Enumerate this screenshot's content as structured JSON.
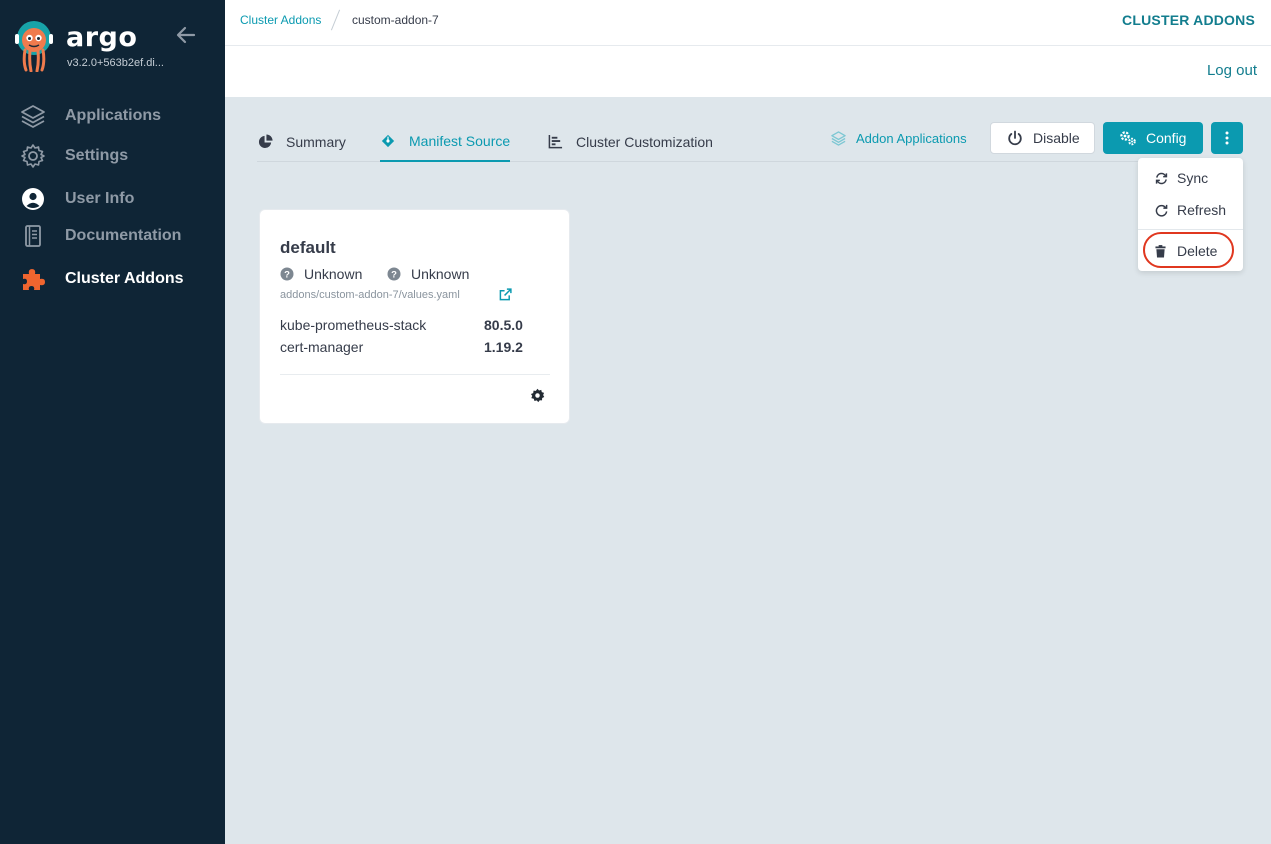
{
  "sidebar": {
    "logo_text": "argo",
    "version": "v3.2.0+563b2ef.di...",
    "items": [
      {
        "label": "Applications",
        "icon": "layers-icon"
      },
      {
        "label": "Settings",
        "icon": "gear-icon"
      },
      {
        "label": "User Info",
        "icon": "user-circle-icon"
      },
      {
        "label": "Documentation",
        "icon": "book-icon"
      },
      {
        "label": "Cluster Addons",
        "icon": "puzzle-icon",
        "active": true
      }
    ]
  },
  "header": {
    "breadcrumb": [
      "Cluster Addons",
      "custom-addon-7"
    ],
    "title": "CLUSTER ADDONS",
    "logout": "Log out"
  },
  "tabs": [
    {
      "label": "Summary",
      "icon": "pie-chart-icon"
    },
    {
      "label": "Manifest Source",
      "icon": "git-diamond-icon",
      "active": true
    },
    {
      "label": "Cluster Customization",
      "icon": "bar-chart-icon"
    }
  ],
  "toolbar": {
    "addon_apps": "Addon Applications",
    "disable": "Disable",
    "config": "Config"
  },
  "menu": {
    "items": [
      {
        "label": "Sync",
        "icon": "sync-icon"
      },
      {
        "label": "Refresh",
        "icon": "refresh-icon"
      },
      {
        "label": "Delete",
        "icon": "trash-icon"
      }
    ]
  },
  "card": {
    "title": "default",
    "status_1": "Unknown",
    "status_2": "Unknown",
    "path": "addons/custom-addon-7/values.yaml",
    "charts": [
      {
        "name": "kube-prometheus-stack",
        "version": "80.5.0"
      },
      {
        "name": "cert-manager",
        "version": "1.19.2"
      }
    ]
  },
  "colors": {
    "sidebar_bg": "#0f2536",
    "accent": "#0b9ab0",
    "accent_dark": "#127d8e",
    "highlight": "#e0371f",
    "puzzle": "#f0652f"
  }
}
